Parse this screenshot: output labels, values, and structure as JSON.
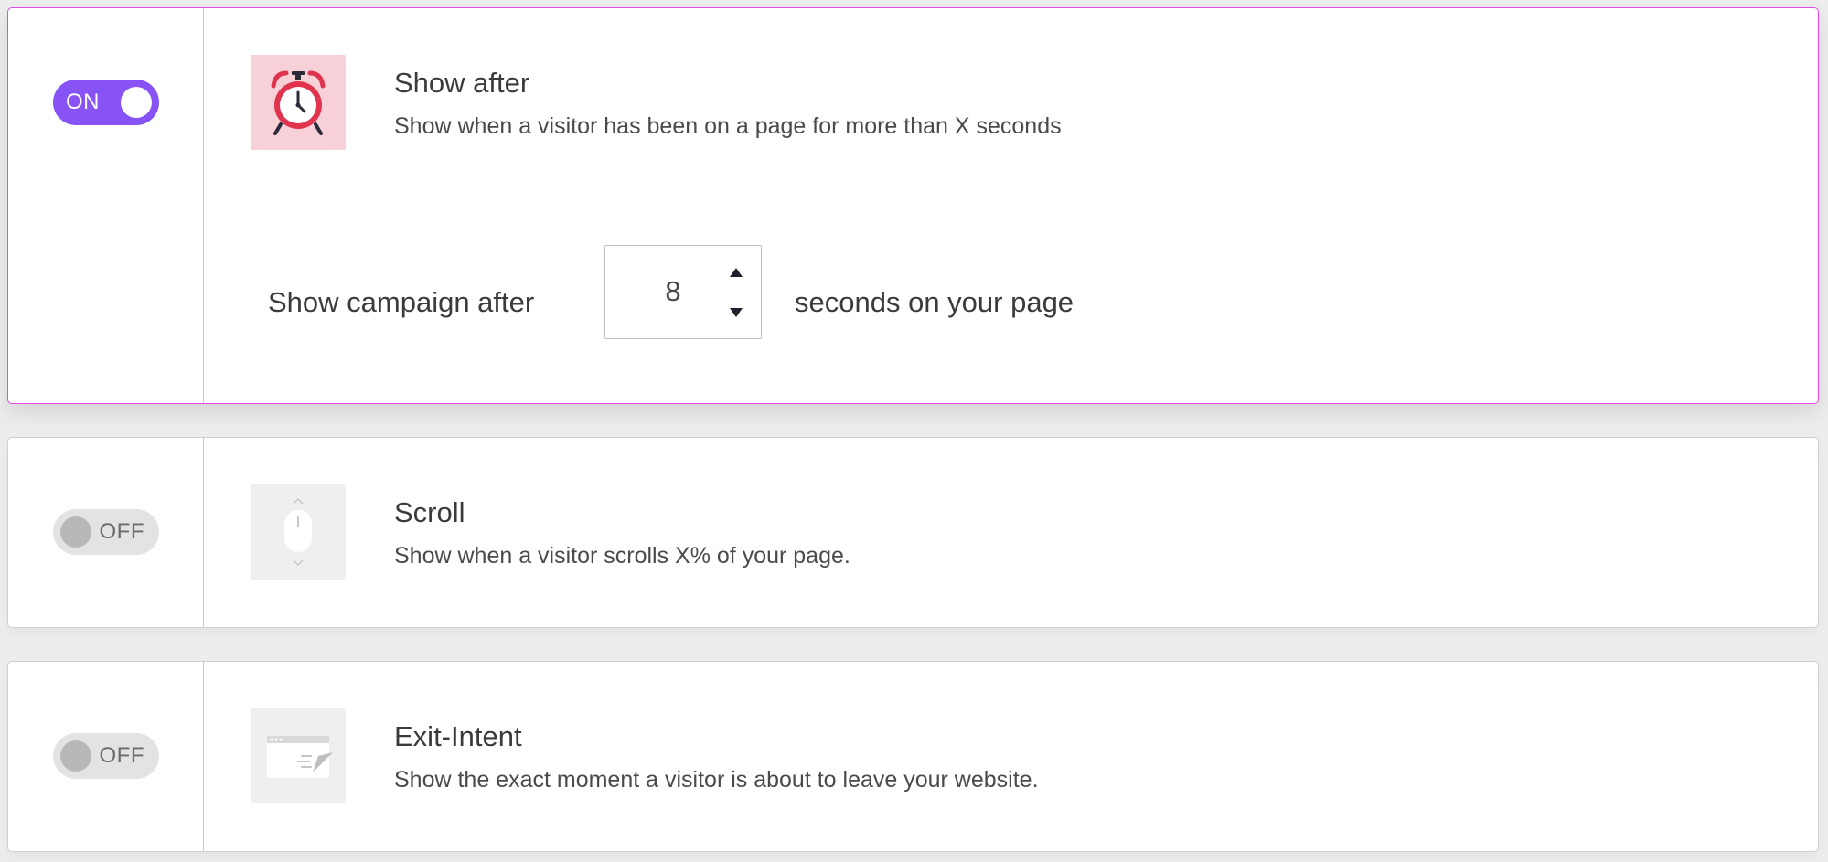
{
  "triggers": [
    {
      "toggle_label": "ON",
      "toggle_state": "on",
      "icon": "alarm-clock-icon",
      "title": "Show after",
      "description": "Show when a visitor has been on a page for more than X seconds",
      "setting": {
        "label_before": "Show campaign after",
        "value": "8",
        "label_after": "seconds on your page"
      }
    },
    {
      "toggle_label": "OFF",
      "toggle_state": "off",
      "icon": "mouse-scroll-icon",
      "title": "Scroll",
      "description": "Show when a visitor scrolls X% of your page."
    },
    {
      "toggle_label": "OFF",
      "toggle_state": "off",
      "icon": "exit-intent-icon",
      "title": "Exit-Intent",
      "description": "Show the exact moment a visitor is about to leave your website."
    }
  ],
  "colors": {
    "toggle_on": "#8753f5",
    "toggle_off": "#e3e3e3",
    "active_border": "#e44be6",
    "clock_icon_bg": "#f8d0d7",
    "clock_red": "#e0334d"
  }
}
